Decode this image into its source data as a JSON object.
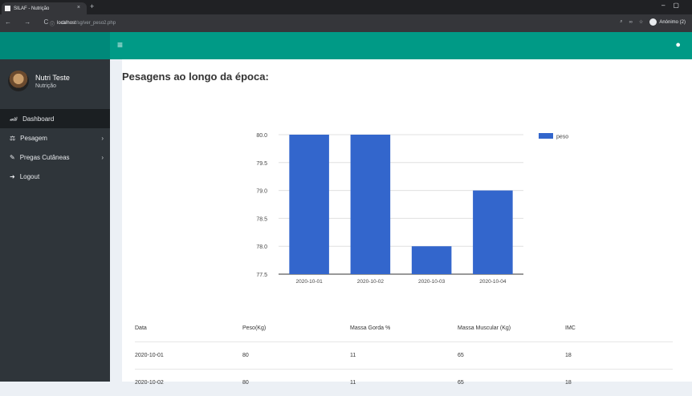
{
  "browser": {
    "tab_title": "SILAF - Nutrição",
    "tab_close": "×",
    "new_tab": "+",
    "nav_icons": "← → C ⌂",
    "url_host": "localhost",
    "url_path": "/sg/ver_peso2.php",
    "profile_label": "Anónimo (2)"
  },
  "header": {
    "menu_icon": "≡",
    "user_icon": "●"
  },
  "sidebar": {
    "user_name": "Nutri Teste",
    "user_role": "Nutrição",
    "items": [
      {
        "icon": "🏎",
        "label": "Dashboard",
        "chevron": ""
      },
      {
        "icon": "⚖",
        "label": "Pesagem",
        "chevron": "›"
      },
      {
        "icon": "✎",
        "label": "Pregas Cutâneas",
        "chevron": "›"
      },
      {
        "icon": "➜",
        "label": "Logout",
        "chevron": ""
      }
    ]
  },
  "page": {
    "title": "Pesagens ao longo da época:"
  },
  "chart_data": {
    "type": "bar",
    "categories": [
      "2020-10-01",
      "2020-10-02",
      "2020-10-03",
      "2020-10-04"
    ],
    "series": [
      {
        "name": "peso",
        "values": [
          80,
          80,
          78,
          79
        ],
        "color": "#3366cc"
      }
    ],
    "y_ticks": [
      "77.5",
      "78.0",
      "78.5",
      "79.0",
      "79.5",
      "80.0"
    ],
    "ylim": [
      77.5,
      80.0
    ],
    "legend": "right",
    "grid": true
  },
  "table": {
    "headers": [
      "Data",
      "Peso(Kg)",
      "Massa Gorda %",
      "Massa Muscular (Kg)",
      "IMC"
    ],
    "rows": [
      [
        "2020-10-01",
        "80",
        "11",
        "65",
        "18"
      ],
      [
        "2020-10-02",
        "80",
        "11",
        "65",
        "18"
      ]
    ]
  }
}
